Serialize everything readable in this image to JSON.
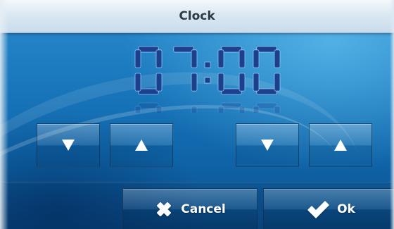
{
  "dialog": {
    "title": "Clock"
  },
  "clock": {
    "hours": "07",
    "minutes": "00",
    "separator": ":",
    "display_color": "#1c3f8e"
  },
  "controls": {
    "hours_down_icon": "arrow-down",
    "hours_up_icon": "arrow-up",
    "minutes_down_icon": "arrow-down",
    "minutes_up_icon": "arrow-up"
  },
  "actions": {
    "cancel_label": "Cancel",
    "cancel_icon": "x-icon",
    "ok_label": "Ok",
    "ok_icon": "checkmark-icon"
  },
  "colors": {
    "title_text": "#2d3a45",
    "background": "#1a78bd"
  }
}
